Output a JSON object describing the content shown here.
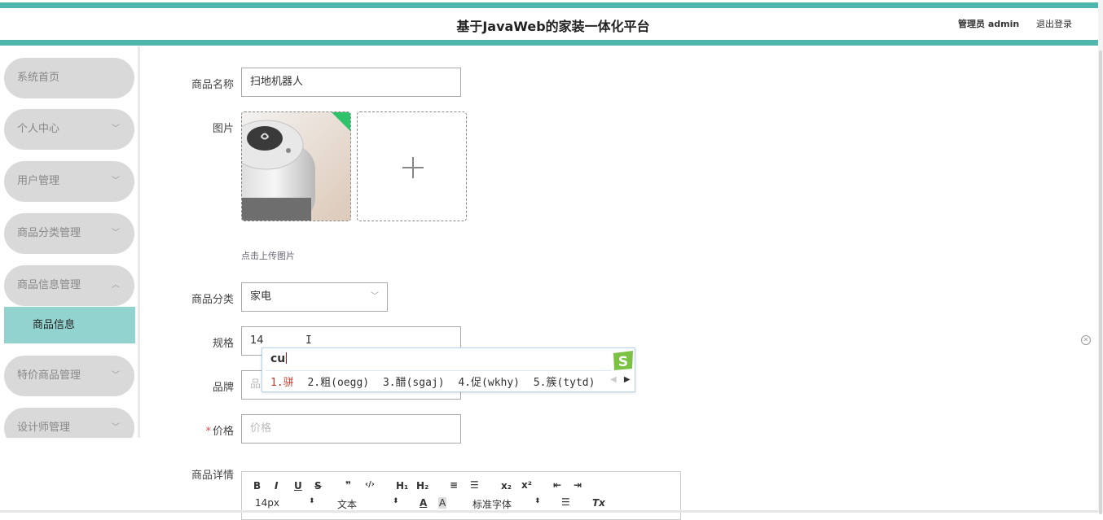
{
  "header": {
    "title": "基于JavaWeb的家装一体化平台",
    "admin_label": "管理员 admin",
    "logout_label": "退出登录",
    "accent_color": "#4fb5ad"
  },
  "sidebar": {
    "items": [
      {
        "label": "系统首页",
        "chevron": ""
      },
      {
        "label": "个人中心",
        "chevron": "﹀"
      },
      {
        "label": "用户管理",
        "chevron": "﹀"
      },
      {
        "label": "商品分类管理",
        "chevron": "﹀"
      },
      {
        "label": "商品信息管理",
        "chevron": "︿"
      },
      {
        "label": "特价商品管理",
        "chevron": "﹀"
      },
      {
        "label": "设计师管理",
        "chevron": "﹀"
      }
    ],
    "active_sub": "商品信息",
    "active_color": "#93d3cf"
  },
  "form": {
    "name_label": "商品名称",
    "name_value": "扫地机器人",
    "image_label": "图片",
    "upload_hint": "点击上传图片",
    "category_label": "商品分类",
    "category_value": "家电",
    "spec_label": "规格",
    "spec_value": "14",
    "brand_label": "品牌",
    "brand_placeholder": "品",
    "price_required": "*",
    "price_label": "价格",
    "price_placeholder": "价格",
    "detail_label": "商品详情"
  },
  "editor": {
    "toolbar_row1": [
      "B",
      "I",
      "U",
      "S",
      "❞",
      "‹/›",
      "H₁",
      "H₂",
      "≡",
      "☰",
      "x₂",
      "x²",
      "⇤",
      "⇥"
    ],
    "font_size": "14px",
    "text_style": "文本",
    "font_family": "标准字体",
    "clear_format": "Tx"
  },
  "ime": {
    "composition": "cu",
    "candidates": [
      "1.骈",
      "2.粗(oegg)",
      "3.醋(sgaj)",
      "4.促(wkhy)",
      "5.簇(tytd)"
    ],
    "logo_icon": "sogou-s-icon"
  }
}
